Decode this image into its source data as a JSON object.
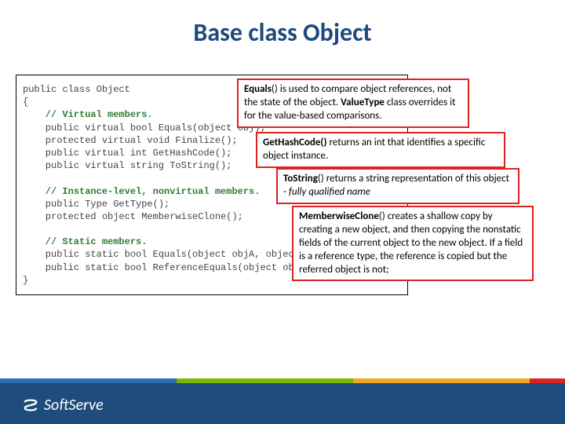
{
  "title": "Base class Object",
  "code": {
    "l1": "public class Object",
    "l2": "{",
    "c1": "    // Virtual members.",
    "l3": "    public virtual bool Equals(object obj);",
    "l4": "    protected virtual void Finalize();",
    "l5": "    public virtual int GetHashCode();",
    "l6": "    public virtual string ToString();",
    "c2": "    // Instance-level, nonvirtual members.",
    "l7": "    public Type GetType();",
    "l8": "    protected object MemberwiseClone();",
    "c3": "    // Static members.",
    "l9": "    public static bool Equals(object objA, object objB);",
    "l10": "    public static bool ReferenceEquals(object objA, object objB);",
    "l11": "}"
  },
  "callouts": {
    "equals_b": "Equals",
    "equals_t": "() is used to compare object references, not the state of the object. ",
    "equals_b2": "ValueType",
    "equals_t2": " class overrides it for the value-based comparisons.",
    "hash_b": "GetHashCode()",
    "hash_t": " returns an int that identifies a specific object instance.",
    "tostr_b": "ToString",
    "tostr_t": "() returns a string representation of this object - ",
    "tostr_i": "fully qualified name",
    "clone_b": "MemberwiseClone",
    "clone_t": "() creates a shallow copy by creating a new object, and then copying the nonstatic fields of the current object to the new object.  If a field is a reference type, the reference is copied but the referred object is not;"
  },
  "brand": "SoftServe"
}
